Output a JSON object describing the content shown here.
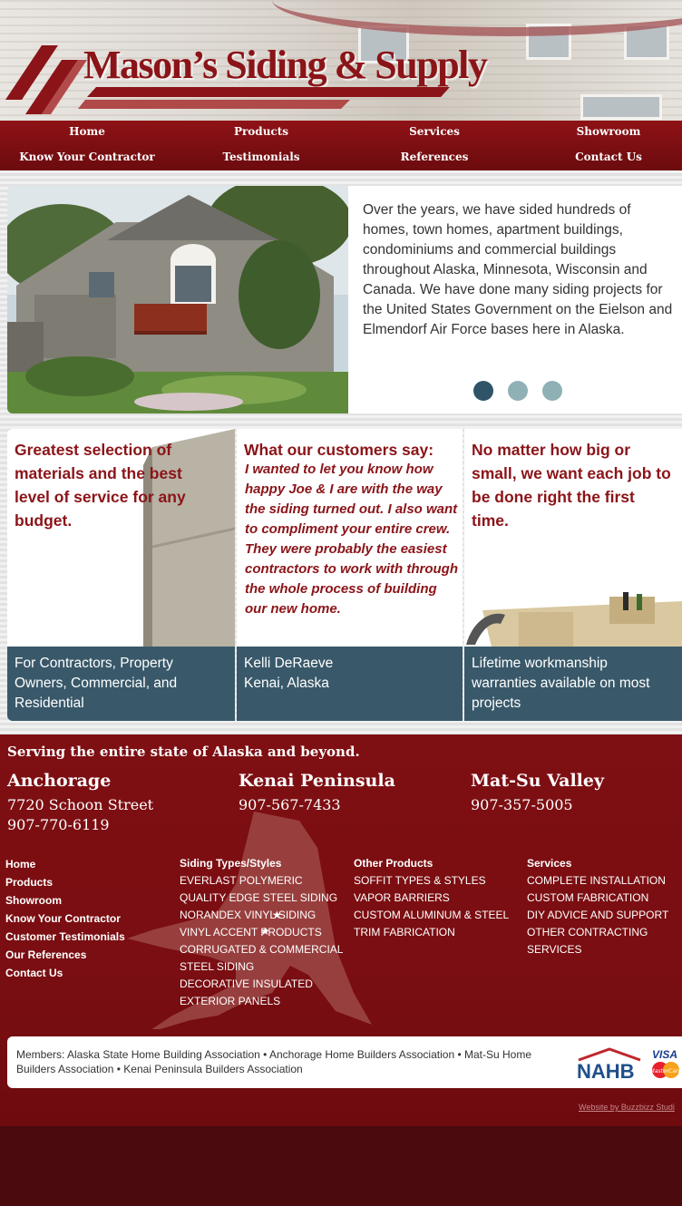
{
  "brand": {
    "name": "Mason’s Siding & Supply"
  },
  "nav": {
    "row1": [
      "Home",
      "Products",
      "Services",
      "Showroom"
    ],
    "row2": [
      "Know Your Contractor",
      "Testimonials",
      "References",
      "Contact Us"
    ]
  },
  "hero": {
    "text": "Over the years, we have sided hundreds of homes, town homes, apartment buildings, condominiums and commercial buildings throughout Alaska, Minnesota, Wisconsin and Canada. We have done many siding projects for the United States Government on the Eielson and Elmendorf Air Force bases here in Alaska.",
    "dots": {
      "active": 0,
      "count": 3,
      "active_color": "#2f5468",
      "inactive_color": "#8fb0b4"
    }
  },
  "columns": [
    {
      "heading": "Greatest selection of materials and the best level of service for any budget.",
      "footer": "For Contractors, Property Owners, Commercial, and Residential"
    },
    {
      "heading": "What our customers say:",
      "quote": "I wanted to let you know how happy Joe & I are with the way the siding turned out. I also want to compliment your entire crew. They were probably the easiest contractors to work with through the whole process of building our new home.",
      "footer_name": "Kelli DeRaeve",
      "footer_place": "Kenai, Alaska"
    },
    {
      "heading": "No matter how big or small, we want each job to be done right the first time.",
      "footer": "Lifetime workmanship warranties available on most projects"
    }
  ],
  "footer": {
    "tagline": "Serving the entire state of Alaska and beyond.",
    "locations": [
      {
        "city": "Anchorage",
        "street": "7720 Schoon Street",
        "phone": "907-770-6119"
      },
      {
        "city": "Kenai Peninsula",
        "phone": "907-567-7433"
      },
      {
        "city": "Mat-Su Valley",
        "phone": "907-357-5005"
      }
    ],
    "links_main": [
      "Home",
      "Products",
      "Showroom",
      "Know Your Contractor",
      "Customer Testimonials",
      "Our References",
      "Contact Us"
    ],
    "siding": {
      "heading": "Siding Types/Styles",
      "items": [
        "EVERLAST POLYMERIC",
        "QUALITY EDGE STEEL SIDING",
        "NORANDEX VINYL SIDING",
        "VINYL ACCENT PRODUCTS",
        "CORRUGATED & COMMERCIAL STEEL SIDING",
        "DECORATIVE INSULATED EXTERIOR PANELS"
      ]
    },
    "other": {
      "heading": "Other Products",
      "items": [
        "SOFFIT TYPES & STYLES",
        "VAPOR BARRIERS",
        "CUSTOM ALUMINUM & STEEL TRIM FABRICATION"
      ]
    },
    "services": {
      "heading": "Services",
      "items": [
        "COMPLETE INSTALLATION",
        "CUSTOM FABRICATION",
        "DIY ADVICE AND SUPPORT",
        "OTHER CONTRACTING SERVICES"
      ]
    },
    "members": "Members: Alaska State Home Building Association • Anchorage Home Builders Association • Mat-Su Home Builders Association • Kenai Peninsula Builders Association",
    "badges": {
      "nahb": "NAHB",
      "visa": "VISA",
      "mastercard": "MasterCard"
    },
    "credit": "Website by Buzzbizz Studi"
  }
}
